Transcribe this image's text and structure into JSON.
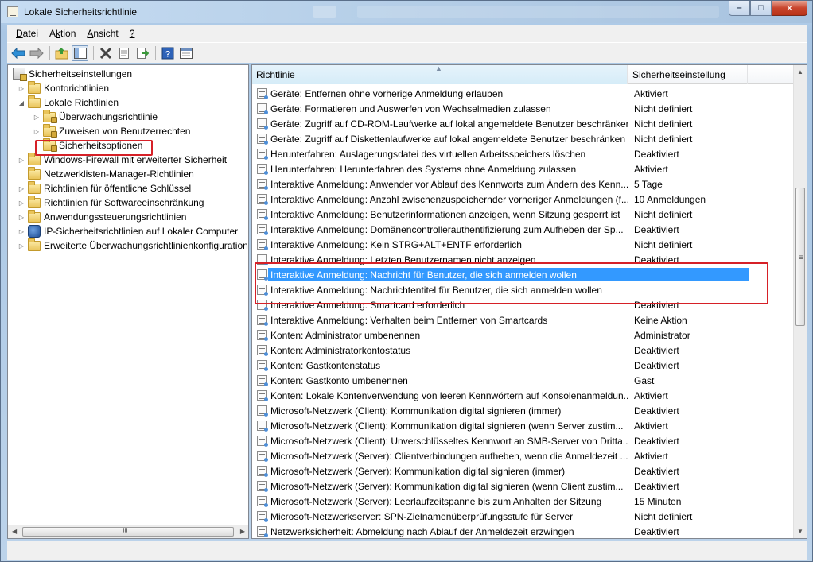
{
  "window": {
    "title": "Lokale Sicherheitsrichtlinie",
    "buttons": {
      "minimize": "–",
      "maximize": "□",
      "close": "✕"
    }
  },
  "menu": [
    {
      "label": "Datei",
      "accel": "D"
    },
    {
      "label": "Aktion",
      "accel": "k"
    },
    {
      "label": "Ansicht",
      "accel": "A"
    },
    {
      "label": "?",
      "accel": "?"
    }
  ],
  "toolbar": {
    "icons": [
      "back-arrow-icon",
      "forward-arrow-icon",
      "up-folder-icon",
      "show-hide-tree-icon",
      "delete-icon",
      "properties-icon",
      "export-list-icon",
      "help-icon",
      "console-view-icon"
    ]
  },
  "tree": {
    "root": "Sicherheitseinstellungen",
    "items": [
      {
        "label": "Kontorichtlinien",
        "level": 1,
        "expander": "collapsed"
      },
      {
        "label": "Lokale Richtlinien",
        "level": 1,
        "expander": "expanded"
      },
      {
        "label": "Überwachungsrichtlinie",
        "level": 2,
        "expander": "collapsed"
      },
      {
        "label": "Zuweisen von Benutzerrechten",
        "level": 2,
        "expander": "collapsed"
      },
      {
        "label": "Sicherheitsoptionen",
        "level": 2,
        "expander": "none",
        "selected": true
      },
      {
        "label": "Windows-Firewall mit erweiterter Sicherheit",
        "level": 1,
        "expander": "collapsed"
      },
      {
        "label": "Netzwerklisten-Manager-Richtlinien",
        "level": 1,
        "expander": "none"
      },
      {
        "label": "Richtlinien für öffentliche Schlüssel",
        "level": 1,
        "expander": "collapsed"
      },
      {
        "label": "Richtlinien für Softwareeinschränkung",
        "level": 1,
        "expander": "collapsed"
      },
      {
        "label": "Anwendungssteuerungsrichtlinien",
        "level": 1,
        "expander": "collapsed"
      },
      {
        "label": "IP-Sicherheitsrichtlinien auf Lokaler Computer",
        "level": 1,
        "expander": "collapsed"
      },
      {
        "label": "Erweiterte Überwachungsrichtlinienkonfiguration",
        "level": 1,
        "expander": "collapsed"
      }
    ]
  },
  "list": {
    "columns": [
      "Richtlinie",
      "Sicherheitseinstellung"
    ],
    "rows": [
      {
        "name": "Geräte: Entfernen ohne vorherige Anmeldung erlauben",
        "setting": "Aktiviert"
      },
      {
        "name": "Geräte: Formatieren und Auswerfen von Wechselmedien zulassen",
        "setting": "Nicht definiert"
      },
      {
        "name": "Geräte: Zugriff auf CD-ROM-Laufwerke auf lokal angemeldete Benutzer beschränken",
        "setting": "Nicht definiert"
      },
      {
        "name": "Geräte: Zugriff auf Diskettenlaufwerke auf lokal angemeldete Benutzer beschränken",
        "setting": "Nicht definiert"
      },
      {
        "name": "Herunterfahren: Auslagerungsdatei des virtuellen Arbeitsspeichers löschen",
        "setting": "Deaktiviert"
      },
      {
        "name": "Herunterfahren: Herunterfahren des Systems ohne Anmeldung zulassen",
        "setting": "Aktiviert"
      },
      {
        "name": "Interaktive Anmeldung: Anwender vor Ablauf des Kennworts zum Ändern des Kenn...",
        "setting": "5 Tage"
      },
      {
        "name": "Interaktive Anmeldung: Anzahl zwischenzuspeichernder vorheriger Anmeldungen (f...",
        "setting": "10 Anmeldungen"
      },
      {
        "name": "Interaktive Anmeldung: Benutzerinformationen anzeigen, wenn Sitzung gesperrt ist",
        "setting": "Nicht definiert"
      },
      {
        "name": "Interaktive Anmeldung: Domänencontrollerauthentifizierung zum Aufheben der Sp...",
        "setting": "Deaktiviert"
      },
      {
        "name": "Interaktive Anmeldung: Kein STRG+ALT+ENTF erforderlich",
        "setting": "Nicht definiert"
      },
      {
        "name": "Interaktive Anmeldung: Letzten Benutzernamen nicht anzeigen",
        "setting": "Deaktiviert"
      },
      {
        "name": "Interaktive Anmeldung: Nachricht für Benutzer, die sich anmelden wollen",
        "setting": "",
        "selected": true
      },
      {
        "name": "Interaktive Anmeldung: Nachrichtentitel für Benutzer, die sich anmelden wollen",
        "setting": ""
      },
      {
        "name": "Interaktive Anmeldung: Smartcard erforderlich",
        "setting": "Deaktiviert"
      },
      {
        "name": "Interaktive Anmeldung: Verhalten beim Entfernen von Smartcards",
        "setting": "Keine Aktion"
      },
      {
        "name": "Konten: Administrator umbenennen",
        "setting": "Administrator"
      },
      {
        "name": "Konten: Administratorkontostatus",
        "setting": "Deaktiviert"
      },
      {
        "name": "Konten: Gastkontenstatus",
        "setting": "Deaktiviert"
      },
      {
        "name": "Konten: Gastkonto umbenennen",
        "setting": "Gast"
      },
      {
        "name": "Konten: Lokale Kontenverwendung von leeren Kennwörtern auf Konsolenanmeldun...",
        "setting": "Aktiviert"
      },
      {
        "name": "Microsoft-Netzwerk (Client): Kommunikation digital signieren (immer)",
        "setting": "Deaktiviert"
      },
      {
        "name": "Microsoft-Netzwerk (Client): Kommunikation digital signieren (wenn Server zustim...",
        "setting": "Aktiviert"
      },
      {
        "name": "Microsoft-Netzwerk (Client): Unverschlüsseltes Kennwort an SMB-Server von Dritta...",
        "setting": "Deaktiviert"
      },
      {
        "name": "Microsoft-Netzwerk (Server): Clientverbindungen aufheben, wenn die Anmeldezeit ...",
        "setting": "Aktiviert"
      },
      {
        "name": "Microsoft-Netzwerk (Server): Kommunikation digital signieren (immer)",
        "setting": "Deaktiviert"
      },
      {
        "name": "Microsoft-Netzwerk (Server): Kommunikation digital signieren (wenn Client zustim...",
        "setting": "Deaktiviert"
      },
      {
        "name": "Microsoft-Netzwerk (Server): Leerlaufzeitspanne bis zum Anhalten der Sitzung",
        "setting": "15 Minuten"
      },
      {
        "name": "Microsoft-Netzwerkserver: SPN-Zielnamenüberprüfungsstufe für Server",
        "setting": "Nicht definiert"
      },
      {
        "name": "Netzwerksicherheit: Abmeldung nach Ablauf der Anmeldezeit erzwingen",
        "setting": "Deaktiviert"
      }
    ]
  },
  "colors": {
    "selection": "#3399ff",
    "highlight_box": "#d62027"
  }
}
